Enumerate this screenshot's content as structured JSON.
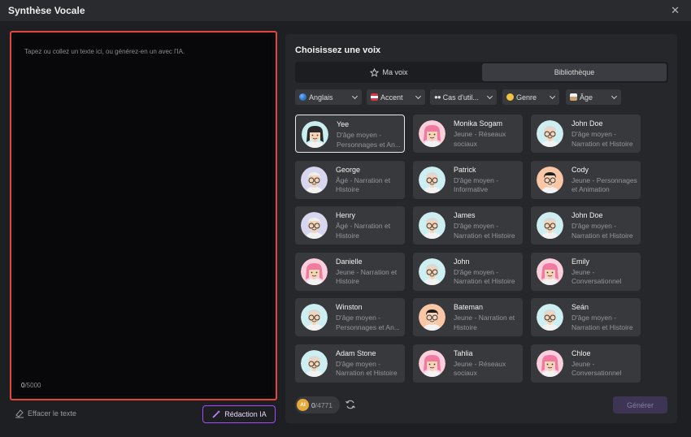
{
  "window": {
    "title": "Synthèse Vocale"
  },
  "editor": {
    "placeholder": "Tapez ou collez un texte ici, ou générez-en un avec l'IA.",
    "count_current": "0",
    "count_max": "/5000",
    "clear_label": "Effacer le texte",
    "ai_label": "Rédaction IA"
  },
  "voices": {
    "heading": "Choisissez une voix",
    "tabs": [
      {
        "label": "Ma voix",
        "icon": "star-icon"
      },
      {
        "label": "Bibliothèque"
      }
    ],
    "filters": [
      {
        "label": "Anglais",
        "icon": "globe-icon"
      },
      {
        "label": "Accent",
        "icon": "flag-icon"
      },
      {
        "label": "Cas d'util...",
        "icon": "eyes-icon"
      },
      {
        "label": "Genre",
        "icon": "person-icon"
      },
      {
        "label": "Âge",
        "icon": "cake-icon"
      }
    ],
    "cards": [
      {
        "name": "Yee",
        "desc": "D'âge moyen - Personnages et An...",
        "avatar": "woman-dark"
      },
      {
        "name": "Monika Sogam",
        "desc": "Jeune - Réseaux sociaux",
        "avatar": "woman-pink"
      },
      {
        "name": "John Doe",
        "desc": "D'âge moyen - Narration et Histoire",
        "avatar": "man-glasses"
      },
      {
        "name": "George",
        "desc": "Âgé - Narration et Histoire",
        "avatar": "old-man"
      },
      {
        "name": "Patrick",
        "desc": "D'âge moyen - Informative",
        "avatar": "man-glasses"
      },
      {
        "name": "Cody",
        "desc": "Jeune - Personnages et Animation",
        "avatar": "man-dark"
      },
      {
        "name": "Henry",
        "desc": "Âgé - Narration et Histoire",
        "avatar": "old-man"
      },
      {
        "name": "James",
        "desc": "D'âge moyen - Narration et Histoire",
        "avatar": "man-glasses"
      },
      {
        "name": "John Doe",
        "desc": "D'âge moyen - Narration et Histoire",
        "avatar": "man-glasses"
      },
      {
        "name": "Danielle",
        "desc": "Jeune - Narration et Histoire",
        "avatar": "woman-pink"
      },
      {
        "name": "John",
        "desc": "D'âge moyen - Narration et Histoire",
        "avatar": "man-glasses"
      },
      {
        "name": "Emily",
        "desc": "Jeune - Conversationnel",
        "avatar": "woman-pink"
      },
      {
        "name": "Winston",
        "desc": "D'âge moyen - Personnages et An...",
        "avatar": "man-glasses"
      },
      {
        "name": "Bateman",
        "desc": "Jeune - Narration et Histoire",
        "avatar": "man-dark"
      },
      {
        "name": "Seán",
        "desc": "D'âge moyen - Narration et Histoire",
        "avatar": "man-glasses"
      },
      {
        "name": "Adam Stone",
        "desc": "D'âge moyen - Narration et Histoire",
        "avatar": "man-glasses"
      },
      {
        "name": "Tahlia",
        "desc": "Jeune - Réseaux sociaux",
        "avatar": "woman-pink"
      },
      {
        "name": "Chloe",
        "desc": "Jeune - Conversationnel",
        "avatar": "woman-pink"
      }
    ],
    "credits_current": "0",
    "credits_total": "/4771",
    "credits_coin": "AI",
    "generate_label": "Générer"
  },
  "colors": {
    "accent_purple": "#a64bff",
    "editor_border": "#e0483e",
    "coin": "#e8a93b"
  }
}
